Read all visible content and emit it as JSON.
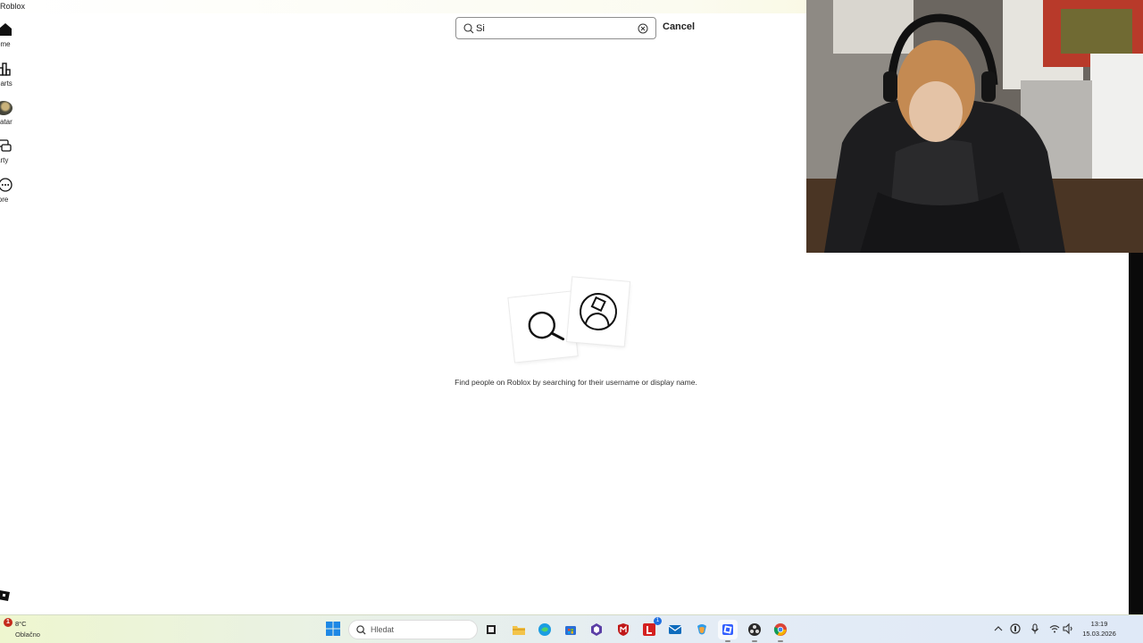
{
  "window": {
    "title": "Roblox"
  },
  "nav": {
    "items": [
      {
        "label": "ome",
        "icon": "home-icon"
      },
      {
        "label": "harts",
        "icon": "charts-icon"
      },
      {
        "label": "vatar",
        "icon": "avatar-icon"
      },
      {
        "label": "arty",
        "icon": "party-icon"
      },
      {
        "label": "lore",
        "icon": "more-icon"
      }
    ]
  },
  "search": {
    "value": "Si",
    "cancel_label": "Cancel"
  },
  "empty_state": {
    "message": "Find people on Roblox by searching for their username or display name."
  },
  "taskbar": {
    "weather": {
      "badge": "1",
      "temp": "8°C",
      "condition": "Oblačno"
    },
    "search_placeholder": "Hledat",
    "apps": [
      {
        "name": "task-view"
      },
      {
        "name": "file-explorer"
      },
      {
        "name": "edge"
      },
      {
        "name": "store"
      },
      {
        "name": "mcafee"
      },
      {
        "name": "vpn"
      },
      {
        "name": "red-l-app",
        "badge": "1"
      },
      {
        "name": "outlook"
      },
      {
        "name": "copilot"
      },
      {
        "name": "roblox"
      },
      {
        "name": "obs"
      },
      {
        "name": "chrome"
      }
    ],
    "clock": {
      "time": "13:19",
      "date": "15.03.2026"
    }
  },
  "colors": {
    "accent": "#1f6fe0",
    "alert": "#c42b1c",
    "text": "#1a1a1a"
  }
}
